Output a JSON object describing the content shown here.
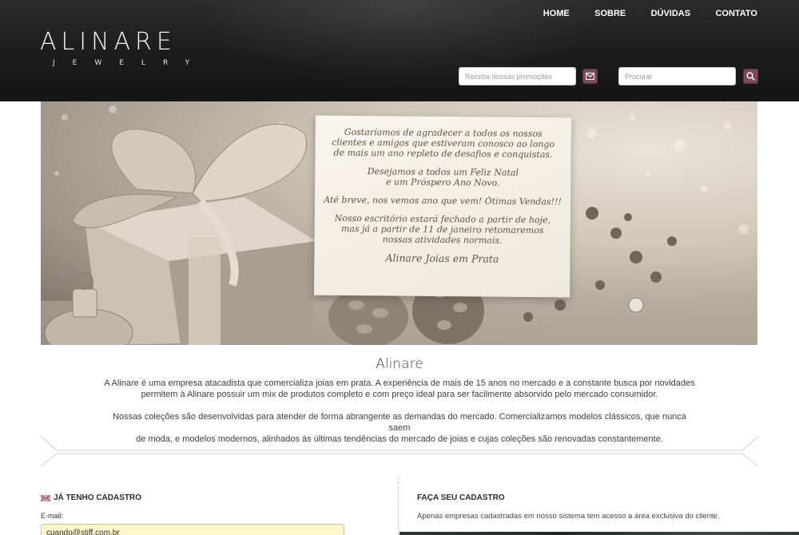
{
  "logo": {
    "main": "ALINARE",
    "sub": "JEWELRY"
  },
  "nav": {
    "items": [
      "HOME",
      "SOBRE",
      "DÚVIDAS",
      "CONTATO"
    ],
    "separator": "·"
  },
  "newsletter": {
    "placeholder": "Receba nossas promoções",
    "button_icon": "mail-icon"
  },
  "search": {
    "placeholder": "Procurar",
    "button_icon": "search-icon"
  },
  "banner": {
    "card_paragraph_1_line_1": "Gostaríamos  de agradecer a todos os nossos",
    "card_paragraph_1_line_2": "clientes e amigos que estiveram conosco ao longo",
    "card_paragraph_1_line_3": "de mais um ano repleto de desafios e conquistas.",
    "card_paragraph_2_line_1": "Desejamos a todos um Feliz Natal",
    "card_paragraph_2_line_2": "e um Próspero Ano Novo.",
    "card_paragraph_3": "Até breve, nos vemos ano que vem! Ótimas Vendas!!!",
    "card_paragraph_4_line_1": "Nosso escritório estará fechado a partir de hoje,",
    "card_paragraph_4_line_2": "mas já a partir de 11 de janeiro retomaremos",
    "card_paragraph_4_line_3": "nossas atividades normais.",
    "card_signature": "Alinare Joias em Prata"
  },
  "about": {
    "title": "Alinare",
    "p1_line_1": "A Alinare é uma empresa atacadista que comercializa joias em prata. A experiência de mais de 15 anos no mercado e a constante busca por novidades",
    "p1_line_2": "permitem à Alinare possuir um mix de produtos completo e com preço ideal para ser facilmente absorvido pelo mercado consumidor.",
    "p2_line_1": "Nossas coleções são desenvolvidas para atender de forma abrangente as demandas do mercado. Comercializamos modelos clássicos, que nunca saem",
    "p2_line_2": "de moda, e modelos modernos, alinhados às últimas tendências do mercado de joias e cujas coleções são renovadas constantemente."
  },
  "login": {
    "title": "JÁ TENHO CADASTRO",
    "title_icon": "envelope-flag-icon",
    "email_label": "E-mail:",
    "email_value": "cuando@stiff.com.br"
  },
  "register": {
    "title": "FAÇA SEU CADASTRO",
    "text": "Apenas empresas cadastradas em nosso sistema tem acesso a área exclusiva do cliente."
  },
  "colors": {
    "header_bg": "#1c1c1c",
    "accent_button": "#7c4b5a",
    "email_field_bg": "#fbf7c8"
  }
}
